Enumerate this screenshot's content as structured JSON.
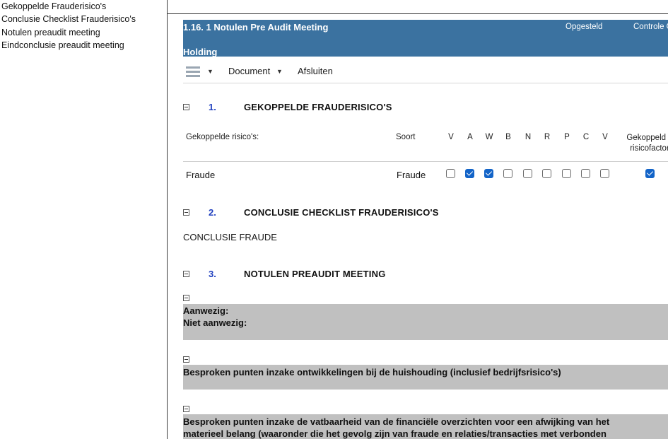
{
  "nav": {
    "items": [
      {
        "label": "Gekoppelde Frauderisico's"
      },
      {
        "label": "Conclusie Checklist Frauderisico's"
      },
      {
        "label": "Notulen preaudit meeting"
      },
      {
        "label": "Eindconclusie preaudit meeting"
      }
    ]
  },
  "header": {
    "title": "1.16.  1 Notulen Pre Audit Meeting",
    "subtitle": "Holding",
    "col1": "Opgesteld",
    "col2": "Controle G"
  },
  "toolbar": {
    "menu_icon": "hamburger-icon",
    "document_label": "Document",
    "close_label": "Afsluiten"
  },
  "section1": {
    "number": "1.",
    "title": "GEKOPPELDE FRAUDERISICO'S",
    "columns": {
      "risk": "Gekoppelde risico's:",
      "type": "Soort",
      "flags": [
        "V",
        "A",
        "W",
        "B",
        "N",
        "R",
        "P",
        "C",
        "V"
      ],
      "linked_line1": "Gekoppeld a",
      "linked_line2": "risicofactor"
    },
    "rows": [
      {
        "risk": "Fraude",
        "type": "Fraude",
        "flags": [
          false,
          true,
          true,
          false,
          false,
          false,
          false,
          false,
          false
        ],
        "linked": true
      }
    ]
  },
  "section2": {
    "number": "2.",
    "title": "CONCLUSIE CHECKLIST FRAUDERISICO'S",
    "text": "CONCLUSIE FRAUDE"
  },
  "section3": {
    "number": "3.",
    "title": "NOTULEN PREAUDIT MEETING",
    "blocks": [
      {
        "line1": "Aanwezig:",
        "line2": "Niet aanwezig:"
      },
      {
        "line1": "Besproken punten inzake ontwikkelingen bij de huishouding (inclusief bedrijfsrisico's)"
      },
      {
        "line1": "Besproken punten inzake de vatbaarheid van de financiële overzichten voor een afwijking van het",
        "line2": "materieel belang (waaronder die het gevolg zijn van fraude en relaties/transacties met verbonden"
      }
    ]
  },
  "colors": {
    "header_bg": "#3b72a0",
    "section_number": "#1f3fbf",
    "checkbox_on": "#1364c8",
    "grey_block": "#c0c0c0"
  }
}
